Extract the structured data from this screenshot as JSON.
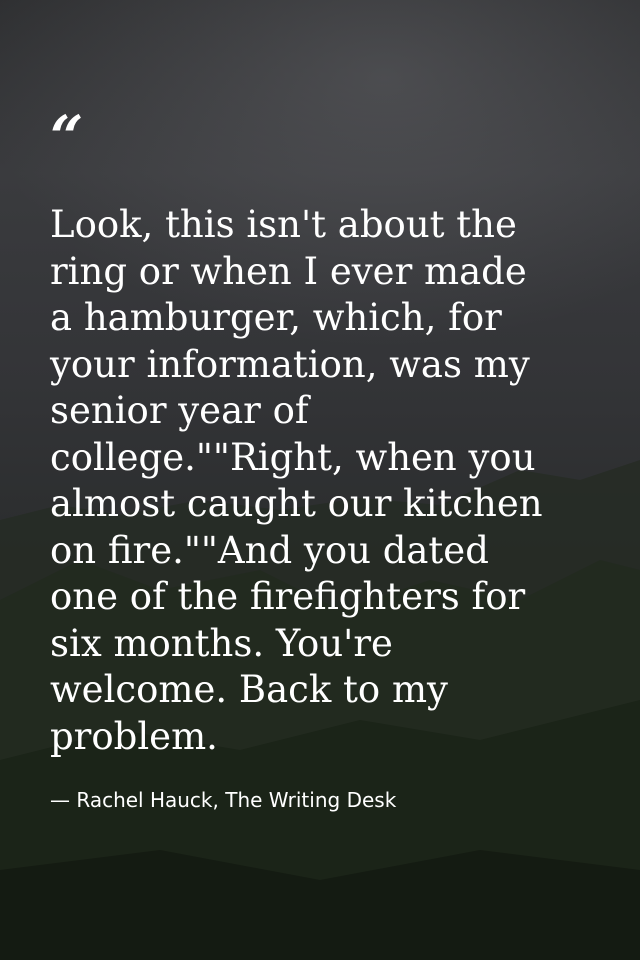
{
  "quote": {
    "mark": "“",
    "lines": [
      "Look, this isn't about the",
      "ring or when I ever made",
      "a hamburger, which, for",
      "your information, was my",
      "senior year of",
      "college.\"\"Right, when you",
      "almost caught our kitchen",
      "on fire.\"\"And you dated",
      "one of the firefighters for",
      "six months. You're",
      "welcome. Back to my",
      "problem."
    ]
  },
  "attribution": "— Rachel Hauck, The Writing Desk",
  "colors": {
    "text": "#ffffff",
    "sky": "#333437",
    "hills": "#1d241b"
  }
}
